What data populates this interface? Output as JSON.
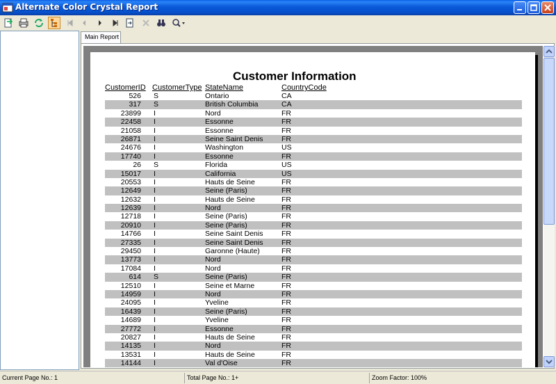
{
  "window": {
    "title": "Alternate Color Crystal Report"
  },
  "toolbar": {
    "buttons": [
      "export",
      "print",
      "refresh",
      "toggle-group-tree",
      "first-page",
      "previous-page",
      "next-page",
      "last-page",
      "goto-page",
      "close-view",
      "find",
      "zoom"
    ]
  },
  "tabs": {
    "main": "Main Report"
  },
  "report": {
    "title": "Customer Information",
    "headers": {
      "customer_id": "CustomerID",
      "customer_type": "CustomerType",
      "state_name": "StateName",
      "country_code": "CountryCode"
    },
    "rows": [
      {
        "id": "526",
        "type": "S",
        "state": "Ontario",
        "country": "CA"
      },
      {
        "id": "317",
        "type": "S",
        "state": "British Columbia",
        "country": "CA"
      },
      {
        "id": "23899",
        "type": "I",
        "state": "Nord",
        "country": "FR"
      },
      {
        "id": "22458",
        "type": "I",
        "state": "Essonne",
        "country": "FR"
      },
      {
        "id": "21058",
        "type": "I",
        "state": "Essonne",
        "country": "FR"
      },
      {
        "id": "26871",
        "type": "I",
        "state": "Seine Saint Denis",
        "country": "FR"
      },
      {
        "id": "24676",
        "type": "I",
        "state": "Washington",
        "country": "US"
      },
      {
        "id": "17740",
        "type": "I",
        "state": "Essonne",
        "country": "FR"
      },
      {
        "id": "26",
        "type": "S",
        "state": "Florida",
        "country": "US"
      },
      {
        "id": "15017",
        "type": "I",
        "state": "California",
        "country": "US"
      },
      {
        "id": "20553",
        "type": "I",
        "state": "Hauts de Seine",
        "country": "FR"
      },
      {
        "id": "12649",
        "type": "I",
        "state": "Seine (Paris)",
        "country": "FR"
      },
      {
        "id": "12632",
        "type": "I",
        "state": "Hauts de Seine",
        "country": "FR"
      },
      {
        "id": "12639",
        "type": "I",
        "state": "Nord",
        "country": "FR"
      },
      {
        "id": "12718",
        "type": "I",
        "state": "Seine (Paris)",
        "country": "FR"
      },
      {
        "id": "20910",
        "type": "I",
        "state": "Seine (Paris)",
        "country": "FR"
      },
      {
        "id": "14766",
        "type": "I",
        "state": "Seine Saint Denis",
        "country": "FR"
      },
      {
        "id": "27335",
        "type": "I",
        "state": "Seine Saint Denis",
        "country": "FR"
      },
      {
        "id": "29450",
        "type": "I",
        "state": "Garonne (Haute)",
        "country": "FR"
      },
      {
        "id": "13773",
        "type": "I",
        "state": "Nord",
        "country": "FR"
      },
      {
        "id": "17084",
        "type": "I",
        "state": "Nord",
        "country": "FR"
      },
      {
        "id": "614",
        "type": "S",
        "state": "Seine (Paris)",
        "country": "FR"
      },
      {
        "id": "12510",
        "type": "I",
        "state": "Seine et Marne",
        "country": "FR"
      },
      {
        "id": "14959",
        "type": "I",
        "state": "Nord",
        "country": "FR"
      },
      {
        "id": "24095",
        "type": "I",
        "state": "Yveline",
        "country": "FR"
      },
      {
        "id": "16439",
        "type": "I",
        "state": "Seine (Paris)",
        "country": "FR"
      },
      {
        "id": "14689",
        "type": "I",
        "state": "Yveline",
        "country": "FR"
      },
      {
        "id": "27772",
        "type": "I",
        "state": "Essonne",
        "country": "FR"
      },
      {
        "id": "20827",
        "type": "I",
        "state": "Hauts de Seine",
        "country": "FR"
      },
      {
        "id": "14135",
        "type": "I",
        "state": "Nord",
        "country": "FR"
      },
      {
        "id": "13531",
        "type": "I",
        "state": "Hauts de Seine",
        "country": "FR"
      },
      {
        "id": "14144",
        "type": "I",
        "state": "Val d'Oise",
        "country": "FR"
      }
    ],
    "alt_row_color": "#c0c0c0"
  },
  "status": {
    "current_page": "Current Page No.: 1",
    "total_pages": "Total Page No.: 1+",
    "zoom": "Zoom Factor: 100%"
  }
}
